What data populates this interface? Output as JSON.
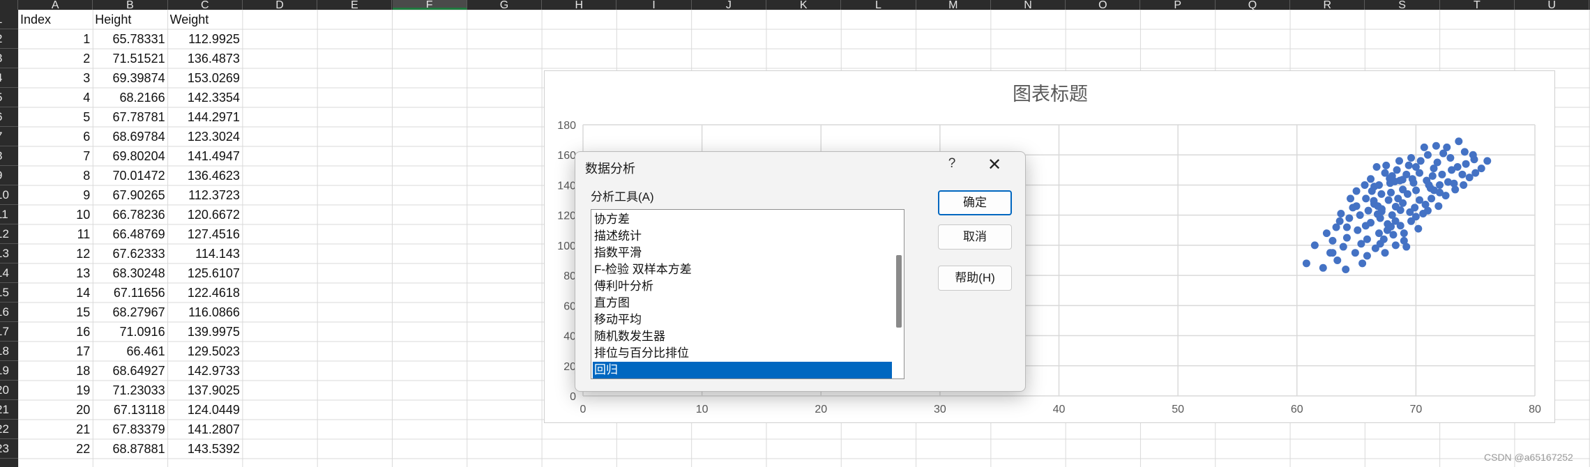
{
  "columns": [
    "A",
    "B",
    "C",
    "D",
    "E",
    "F",
    "G",
    "H",
    "I",
    "J",
    "K",
    "L",
    "M",
    "N",
    "O",
    "P",
    "Q",
    "R",
    "S",
    "T",
    "U"
  ],
  "selected_column": "F",
  "rows": [
    "1",
    "2",
    "3",
    "4",
    "5",
    "6",
    "7",
    "8",
    "9",
    "10",
    "11",
    "12",
    "13",
    "14",
    "15",
    "16",
    "17",
    "18",
    "19",
    "20",
    "21",
    "22",
    "23"
  ],
  "sheet": {
    "headers": [
      "Index",
      "Height",
      "Weight"
    ],
    "data": [
      [
        "1",
        "65.78331",
        "112.9925"
      ],
      [
        "2",
        "71.51521",
        "136.4873"
      ],
      [
        "3",
        "69.39874",
        "153.0269"
      ],
      [
        "4",
        "68.2166",
        "142.3354"
      ],
      [
        "5",
        "67.78781",
        "144.2971"
      ],
      [
        "6",
        "68.69784",
        "123.3024"
      ],
      [
        "7",
        "69.80204",
        "141.4947"
      ],
      [
        "8",
        "70.01472",
        "136.4623"
      ],
      [
        "9",
        "67.90265",
        "112.3723"
      ],
      [
        "10",
        "66.78236",
        "120.6672"
      ],
      [
        "11",
        "66.48769",
        "127.4516"
      ],
      [
        "12",
        "67.62333",
        "114.143"
      ],
      [
        "13",
        "68.30248",
        "125.6107"
      ],
      [
        "14",
        "67.11656",
        "122.4618"
      ],
      [
        "15",
        "68.27967",
        "116.0866"
      ],
      [
        "16",
        "71.0916",
        "139.9975"
      ],
      [
        "17",
        "66.461",
        "129.5023"
      ],
      [
        "18",
        "68.64927",
        "142.9733"
      ],
      [
        "19",
        "71.23033",
        "137.9025"
      ],
      [
        "20",
        "67.13118",
        "124.0449"
      ],
      [
        "21",
        "67.83379",
        "141.2807"
      ],
      [
        "22",
        "68.87881",
        "143.5392"
      ]
    ]
  },
  "chart_data": {
    "type": "scatter",
    "title": "图表标题",
    "xlim": [
      0,
      80
    ],
    "ylim": [
      0,
      180
    ],
    "x_ticks": [
      "0",
      "10",
      "20",
      "30",
      "40",
      "50",
      "60",
      "70",
      "80"
    ],
    "y_ticks": [
      "0",
      "20",
      "40",
      "60",
      "80",
      "100",
      "120",
      "140",
      "160",
      "180"
    ],
    "grid": true,
    "marker_color": "#4472c4",
    "points": [
      [
        65.78,
        112.99
      ],
      [
        71.52,
        136.49
      ],
      [
        69.4,
        153.03
      ],
      [
        68.22,
        142.34
      ],
      [
        67.79,
        144.3
      ],
      [
        68.7,
        123.3
      ],
      [
        69.8,
        141.49
      ],
      [
        70.01,
        136.46
      ],
      [
        67.9,
        112.37
      ],
      [
        66.78,
        120.67
      ],
      [
        66.49,
        127.45
      ],
      [
        67.62,
        114.14
      ],
      [
        68.3,
        125.61
      ],
      [
        67.12,
        122.46
      ],
      [
        68.28,
        116.09
      ],
      [
        71.09,
        140.0
      ],
      [
        66.46,
        129.5
      ],
      [
        68.65,
        142.97
      ],
      [
        71.23,
        137.9
      ],
      [
        67.13,
        124.04
      ],
      [
        67.83,
        141.28
      ],
      [
        68.88,
        143.54
      ],
      [
        60.8,
        88
      ],
      [
        62.2,
        85
      ],
      [
        63.4,
        90
      ],
      [
        64.1,
        84
      ],
      [
        65.5,
        88
      ],
      [
        62.8,
        95
      ],
      [
        63.9,
        99
      ],
      [
        64.9,
        95
      ],
      [
        65.9,
        93
      ],
      [
        66.6,
        98
      ],
      [
        67.4,
        95
      ],
      [
        68.3,
        100
      ],
      [
        69.2,
        99
      ],
      [
        63.0,
        103
      ],
      [
        62.5,
        108
      ],
      [
        63.3,
        112
      ],
      [
        64.2,
        105
      ],
      [
        64.4,
        118
      ],
      [
        65.1,
        110
      ],
      [
        65.9,
        104
      ],
      [
        66.2,
        115
      ],
      [
        66.9,
        108
      ],
      [
        67.3,
        104
      ],
      [
        67.6,
        110
      ],
      [
        68.1,
        107
      ],
      [
        68.7,
        113
      ],
      [
        69.0,
        108
      ],
      [
        69.6,
        116
      ],
      [
        70.2,
        111
      ],
      [
        70.6,
        121
      ],
      [
        63.7,
        121
      ],
      [
        64.7,
        125
      ],
      [
        65.3,
        120
      ],
      [
        65.8,
        131
      ],
      [
        66.3,
        136
      ],
      [
        66.8,
        126
      ],
      [
        67.1,
        134
      ],
      [
        67.7,
        130
      ],
      [
        68.0,
        120
      ],
      [
        68.5,
        131
      ],
      [
        68.9,
        128
      ],
      [
        69.3,
        134
      ],
      [
        69.9,
        125
      ],
      [
        70.3,
        130
      ],
      [
        70.8,
        127
      ],
      [
        71.3,
        131
      ],
      [
        71.9,
        126
      ],
      [
        72.5,
        133
      ],
      [
        64.5,
        131
      ],
      [
        65.0,
        136
      ],
      [
        65.7,
        140
      ],
      [
        66.2,
        144
      ],
      [
        66.9,
        140
      ],
      [
        67.4,
        148
      ],
      [
        67.9,
        135
      ],
      [
        68.4,
        150
      ],
      [
        68.9,
        137
      ],
      [
        69.2,
        147
      ],
      [
        69.7,
        144
      ],
      [
        70.3,
        148
      ],
      [
        70.9,
        143
      ],
      [
        71.4,
        146
      ],
      [
        72.0,
        140
      ],
      [
        72.7,
        142
      ],
      [
        73.3,
        137
      ],
      [
        73.9,
        147
      ],
      [
        74.5,
        145
      ],
      [
        66.7,
        152
      ],
      [
        67.5,
        153
      ],
      [
        68.6,
        156
      ],
      [
        69.6,
        158
      ],
      [
        70.4,
        156
      ],
      [
        71.0,
        160
      ],
      [
        71.8,
        155
      ],
      [
        72.3,
        161
      ],
      [
        72.9,
        158
      ],
      [
        73.5,
        152
      ],
      [
        74.2,
        154
      ],
      [
        74.9,
        157
      ],
      [
        75.5,
        151
      ],
      [
        76.0,
        156
      ],
      [
        70.7,
        165
      ],
      [
        71.7,
        166
      ],
      [
        72.6,
        165
      ],
      [
        73.6,
        169
      ],
      [
        74.1,
        162
      ],
      [
        65.0,
        126
      ],
      [
        66.0,
        123
      ],
      [
        67.0,
        118
      ],
      [
        69.5,
        122
      ],
      [
        70.0,
        119
      ],
      [
        71.0,
        123
      ],
      [
        72.0,
        135
      ],
      [
        71.5,
        151
      ],
      [
        70.0,
        152
      ],
      [
        68.0,
        146
      ],
      [
        66.5,
        139
      ],
      [
        64.2,
        112
      ],
      [
        63.6,
        116
      ],
      [
        65.4,
        101
      ],
      [
        67.0,
        101
      ],
      [
        69.0,
        103
      ],
      [
        72.2,
        147
      ],
      [
        73.0,
        150
      ],
      [
        74.0,
        140
      ],
      [
        73.2,
        141
      ],
      [
        75.0,
        148
      ],
      [
        63.0,
        95
      ],
      [
        61.5,
        100
      ],
      [
        74.8,
        160
      ]
    ]
  },
  "dialog": {
    "title": "数据分析",
    "help_glyph": "?",
    "close_glyph": "✕",
    "tools_label": "分析工具(A)",
    "items": [
      "协方差",
      "描述统计",
      "指数平滑",
      "F-检验 双样本方差",
      "傅利叶分析",
      "直方图",
      "移动平均",
      "随机数发生器",
      "排位与百分比排位",
      "回归"
    ],
    "selected_item": "回归",
    "ok": "确定",
    "cancel": "取消",
    "help_button": "帮助(H)"
  },
  "watermark": "CSDN @a65167252"
}
